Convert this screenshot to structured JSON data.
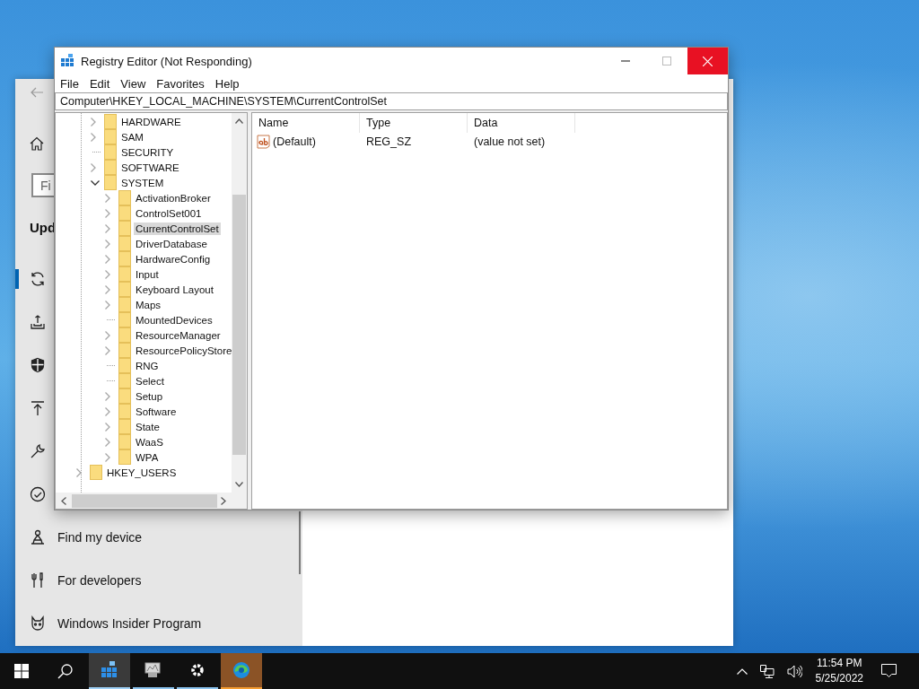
{
  "settings_window": {
    "search": {
      "placeholder": "Fi"
    },
    "heading": "Upd",
    "nav_items": [
      {
        "selected": true
      },
      {
        "selected": false
      },
      {
        "selected": false
      },
      {
        "selected": false
      },
      {
        "selected": false
      },
      {
        "selected": false
      },
      {
        "label": "Find my device",
        "selected": false
      },
      {
        "label": "For developers",
        "selected": false
      },
      {
        "label": "Windows Insider Program",
        "selected": false
      }
    ]
  },
  "registry_editor": {
    "title": "Registry Editor (Not Responding)",
    "menu": [
      "File",
      "Edit",
      "View",
      "Favorites",
      "Help"
    ],
    "address": "Computer\\HKEY_LOCAL_MACHINE\\SYSTEM\\CurrentControlSet",
    "tree": [
      {
        "children": [
          {
            "label": "HARDWARE",
            "expandable": true,
            "expanded": false,
            "selected": false
          },
          {
            "label": "SAM",
            "expandable": true,
            "expanded": false,
            "selected": false
          },
          {
            "label": "SECURITY",
            "expandable": false,
            "selected": false
          },
          {
            "label": "SOFTWARE",
            "expandable": true,
            "expanded": false,
            "selected": false
          },
          {
            "label": "SYSTEM",
            "expandable": true,
            "expanded": true,
            "selected": false,
            "children": [
              {
                "label": "ActivationBroker",
                "expandable": true,
                "expanded": false,
                "selected": false
              },
              {
                "label": "ControlSet001",
                "expandable": true,
                "expanded": false,
                "selected": false
              },
              {
                "label": "CurrentControlSet",
                "expandable": true,
                "expanded": false,
                "selected": true
              },
              {
                "label": "DriverDatabase",
                "expandable": true,
                "expanded": false,
                "selected": false
              },
              {
                "label": "HardwareConfig",
                "expandable": true,
                "expanded": false,
                "selected": false
              },
              {
                "label": "Input",
                "expandable": true,
                "expanded": false,
                "selected": false
              },
              {
                "label": "Keyboard Layout",
                "expandable": true,
                "expanded": false,
                "selected": false
              },
              {
                "label": "Maps",
                "expandable": true,
                "expanded": false,
                "selected": false
              },
              {
                "label": "MountedDevices",
                "expandable": false,
                "selected": false
              },
              {
                "label": "ResourceManager",
                "expandable": true,
                "expanded": false,
                "selected": false
              },
              {
                "label": "ResourcePolicyStore",
                "expandable": true,
                "expanded": false,
                "selected": false
              },
              {
                "label": "RNG",
                "expandable": false,
                "selected": false
              },
              {
                "label": "Select",
                "expandable": false,
                "selected": false
              },
              {
                "label": "Setup",
                "expandable": true,
                "expanded": false,
                "selected": false
              },
              {
                "label": "Software",
                "expandable": true,
                "expanded": false,
                "selected": false
              },
              {
                "label": "State",
                "expandable": true,
                "expanded": false,
                "selected": false
              },
              {
                "label": "WaaS",
                "expandable": true,
                "expanded": false,
                "selected": false
              },
              {
                "label": "WPA",
                "expandable": true,
                "expanded": false,
                "selected": false
              }
            ]
          }
        ]
      },
      {
        "label": "HKEY_USERS",
        "expandable": true,
        "expanded": false,
        "selected": false
      }
    ],
    "columns": [
      "Name",
      "Type",
      "Data"
    ],
    "values": [
      {
        "name": "(Default)",
        "type": "REG_SZ",
        "data": "(value not set)"
      }
    ]
  },
  "taskbar": {
    "apps": [
      {
        "selected": true,
        "attention": false
      },
      {
        "selected": false,
        "attention": false
      },
      {
        "selected": false,
        "attention": false
      },
      {
        "selected": false,
        "attention": true
      }
    ],
    "clock": {
      "time": "11:54 PM",
      "date": "5/25/2022"
    }
  }
}
